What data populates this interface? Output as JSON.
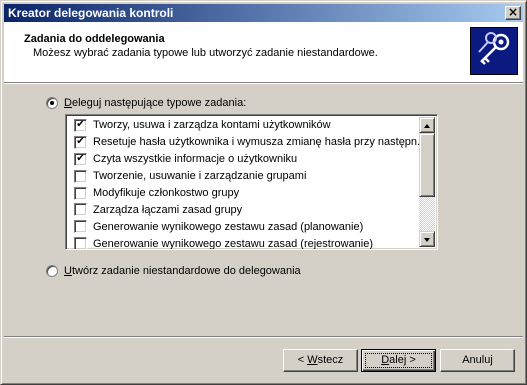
{
  "window": {
    "title": "Kreator delegowania kontroli",
    "close_glyph": "×"
  },
  "header": {
    "title": "Zadania do oddelegowania",
    "subtitle": "Możesz wybrać zadania typowe lub utworzyć zadanie niestandardowe.",
    "icon": "keys-icon"
  },
  "option_common": {
    "label_pre": "",
    "label_u": "D",
    "label_post": "eleguj następujące typowe zadania:",
    "selected": true
  },
  "tasks": [
    {
      "label": "Tworzy, usuwa i zarządza kontami użytkowników",
      "checked": true
    },
    {
      "label": "Resetuje hasła użytkownika i wymusza zmianę hasła przy następn...",
      "checked": true
    },
    {
      "label": "Czyta wszystkie informacje o użytkowniku",
      "checked": true
    },
    {
      "label": "Tworzenie, usuwanie i zarządzanie grupami",
      "checked": false
    },
    {
      "label": "Modyfikuje członkostwo grupy",
      "checked": false
    },
    {
      "label": "Zarządza łączami zasad grupy",
      "checked": false
    },
    {
      "label": "Generowanie wynikowego zestawu zasad (planowanie)",
      "checked": false
    },
    {
      "label": "Generowanie wynikowego zestawu zasad (rejestrowanie)",
      "checked": false
    }
  ],
  "option_custom": {
    "label_pre": "",
    "label_u": "U",
    "label_post": "twórz zadanie niestandardowe do delegowania",
    "selected": false
  },
  "buttons": {
    "back": {
      "pre": "< ",
      "u": "W",
      "post": "stecz"
    },
    "next": {
      "pre": "",
      "u": "D",
      "post": "alej >"
    },
    "cancel": {
      "label": "Anuluj"
    }
  },
  "check_glyph": "✔"
}
